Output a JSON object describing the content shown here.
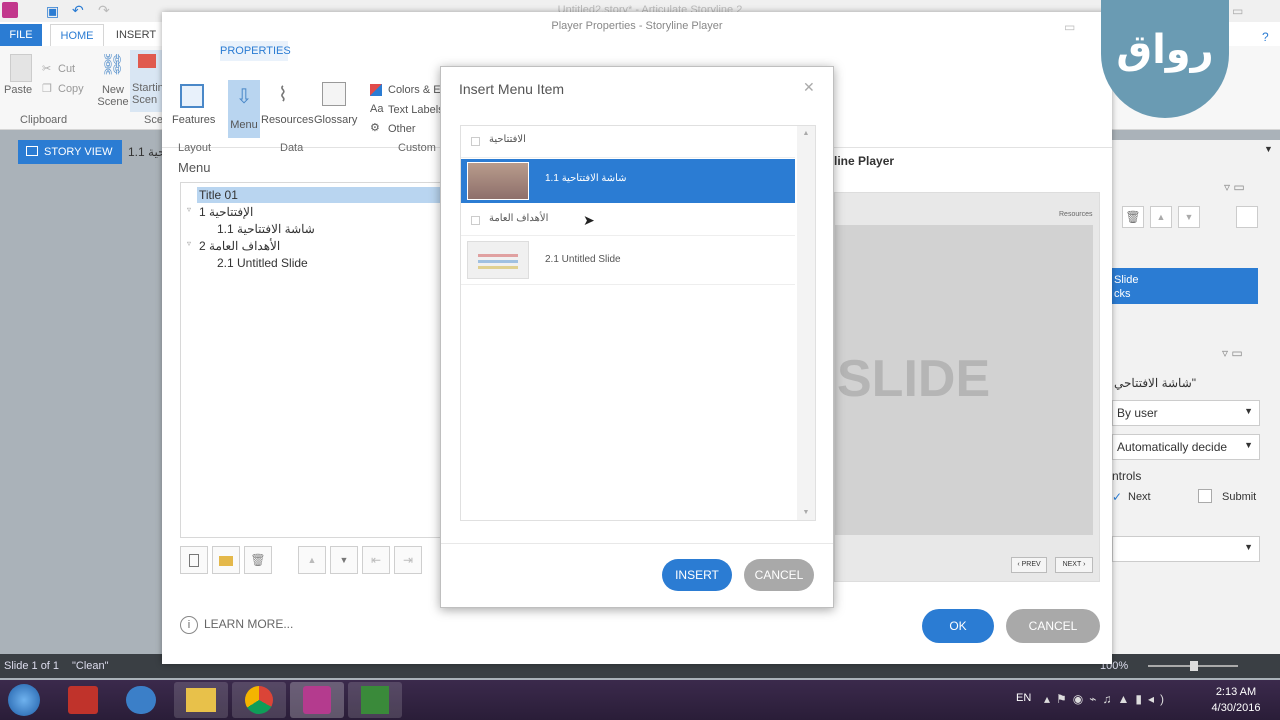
{
  "app": {
    "window_title": "Untitled2.story* - Articulate Storyline 2",
    "tabs": {
      "file": "FILE",
      "home": "HOME",
      "insert": "INSERT"
    },
    "clipboard": {
      "paste": "Paste",
      "cut": "Cut",
      "copy": "Copy",
      "group": "Clipboard"
    },
    "new_scene": "New\nScene",
    "starting_scene": "Startin\nScen",
    "scene_group": "Sce",
    "story_view": "STORY VIEW",
    "slide_tab": "1.1 حية"
  },
  "player_properties": {
    "title": "Player Properties - Storyline Player",
    "properties_tab": "PROPERTIES",
    "buttons": {
      "features": "Features",
      "menu": "Menu",
      "resources": "Resources",
      "glossary": "Glossary"
    },
    "custom": {
      "colors": "Colors & Eff",
      "text_labels": "Text Labels",
      "other": "Other"
    },
    "groups": {
      "layout": "Layout",
      "data": "Data",
      "custom": "Custom"
    },
    "menu_label": "Menu",
    "tree": [
      "Title 01",
      "1 الإفتتاحية",
      "1.1 شاشة الافتتاحية",
      "2 الأهداف العامة",
      "2.1 Untitled Slide"
    ],
    "learn_more": "LEARN MORE...",
    "ok": "OK",
    "cancel": "CANCEL",
    "preview_title": "line Player",
    "preview_resources": "Resources",
    "preview_slide_text": "SLIDE",
    "preview_prev": "‹ PREV",
    "preview_next": "NEXT ›"
  },
  "right_panel": {
    "selected_lines": [
      "Slide",
      "cks"
    ],
    "slide_name": "شاشة الافتتاحي\"",
    "advance": "By user",
    "revisit": "Automatically decide",
    "controls_label": "ntrols",
    "next": "Next",
    "submit": "Submit"
  },
  "dialog": {
    "title": "Insert Menu Item",
    "items": [
      {
        "label": "الافتتاحية",
        "type": "scene"
      },
      {
        "label": "1.1 شاشة الافتتاحية",
        "type": "slide",
        "selected": true
      },
      {
        "label": "الأهداف العامة",
        "type": "scene"
      },
      {
        "label": "2.1 Untitled Slide",
        "type": "slide"
      }
    ],
    "insert": "INSERT",
    "cancel": "CANCEL"
  },
  "statusbar": {
    "slide": "Slide 1 of 1",
    "theme": "\"Clean\"",
    "zoom": "100%"
  },
  "taskbar": {
    "lang": "EN",
    "time": "2:13 AM",
    "date": "4/30/2016"
  },
  "logo_text": "رواق",
  "colors": {
    "accent": "#2b7cd3",
    "logo": "#6a9bb3",
    "taskbar": "#2f2140"
  }
}
